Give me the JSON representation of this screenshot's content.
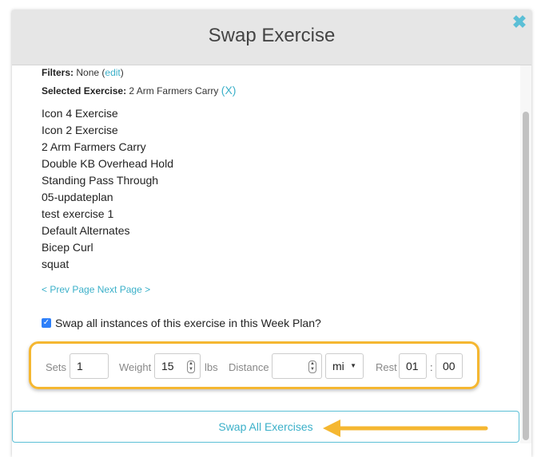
{
  "modal": {
    "title": "Swap Exercise",
    "close_icon": "close-x-icon"
  },
  "filters": {
    "label": "Filters:",
    "value": "None",
    "edit_open": "(",
    "edit_link": "edit",
    "edit_close": ")"
  },
  "selected": {
    "label": "Selected Exercise:",
    "value": "2 Arm Farmers Carry",
    "remove": "(X)"
  },
  "exercises": [
    "Icon 4 Exercise",
    "Icon 2 Exercise",
    "2 Arm Farmers Carry",
    "Double KB Overhead Hold",
    "Standing Pass Through",
    "05-updateplan",
    "test exercise 1",
    "Default Alternates",
    "Bicep Curl",
    "squat"
  ],
  "pager": {
    "prev": "< Prev Page",
    "next": "Next Page >"
  },
  "swap_all_instances": {
    "checked": true,
    "label": "Swap all instances of this exercise in this Week Plan?"
  },
  "fields": {
    "sets_label": "Sets",
    "sets_value": "1",
    "weight_label": "Weight",
    "weight_value": "15",
    "weight_unit": "lbs",
    "distance_label": "Distance",
    "distance_value": "",
    "distance_unit": "mi",
    "rest_label": "Rest",
    "rest_minutes": "01",
    "rest_colon": ":",
    "rest_seconds": "00"
  },
  "swap_button": "Swap All Exercises",
  "colors": {
    "accent": "#3bb0c9",
    "highlight": "#f5b731",
    "header_bg": "#e6e6e6"
  }
}
